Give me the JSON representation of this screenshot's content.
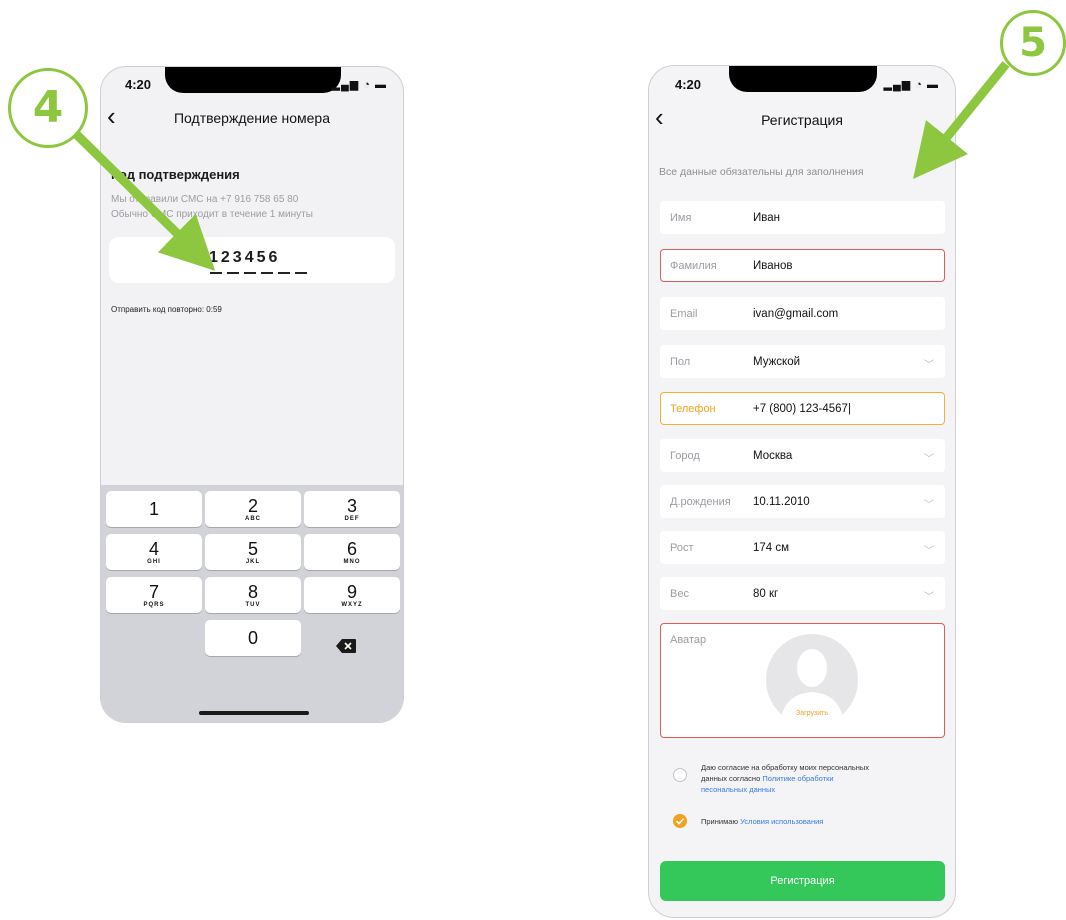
{
  "phone1": {
    "status_time": "4:20",
    "status_icons": "▂▄▆ ◔ ▬",
    "title": "Подтверждение номера",
    "code_heading": "Код подтверждения",
    "sms_line1": "Мы отправили СМС на +7 916 758 65 80",
    "sms_line2": "Обычно СМС приходит в течение 1 минуты",
    "code_value": "123456",
    "resend": "Отправить код повторно: 0:59",
    "keys": [
      {
        "num": "1",
        "letters": ""
      },
      {
        "num": "2",
        "letters": "ABC"
      },
      {
        "num": "3",
        "letters": "DEF"
      },
      {
        "num": "4",
        "letters": "GHI"
      },
      {
        "num": "5",
        "letters": "JKL"
      },
      {
        "num": "6",
        "letters": "MNO"
      },
      {
        "num": "7",
        "letters": "PQRS"
      },
      {
        "num": "8",
        "letters": "TUV"
      },
      {
        "num": "9",
        "letters": "WXYZ"
      },
      {
        "num": "0",
        "letters": ""
      }
    ]
  },
  "phone2": {
    "status_time": "4:20",
    "status_icons": "▂▄▆ ◔ ▬",
    "title": "Регистрация",
    "note": "Все данные обязательны для заполнения",
    "fields": [
      {
        "label": "Имя",
        "value": "Иван",
        "state": "normal",
        "dropdown": false
      },
      {
        "label": "Фамилия",
        "value": "Иванов",
        "state": "error",
        "dropdown": false
      },
      {
        "label": "Email",
        "value": "ivan@gmail.com",
        "state": "normal",
        "dropdown": false
      },
      {
        "label": "Пол",
        "value": "Мужской",
        "state": "normal",
        "dropdown": true
      },
      {
        "label": "Телефон",
        "value": "+7 (800) 123-4567|",
        "state": "focus",
        "dropdown": false
      },
      {
        "label": "Город",
        "value": "Москва",
        "state": "normal",
        "dropdown": true
      },
      {
        "label": "Д.рождения",
        "value": "10.11.2010",
        "state": "normal",
        "dropdown": true
      },
      {
        "label": "Рост",
        "value": "174 см",
        "state": "normal",
        "dropdown": true
      },
      {
        "label": "Вес",
        "value": "80 кг",
        "state": "normal",
        "dropdown": true
      }
    ],
    "avatar_label": "Аватар",
    "upload_label": "Загрузить",
    "consent_prefix_line1": "Даю согласие на обработку моих персональных",
    "consent_prefix_line2": "данных согласно ",
    "consent_link_line2": "Политике обработки",
    "consent_link_line3": "песональных данных",
    "consent_checked": false,
    "terms_prefix": "Принимаю ",
    "terms_link": "Условия использования",
    "terms_checked": true,
    "register_button": "Регистрация"
  },
  "badges": {
    "step4": "4",
    "step5": "5"
  },
  "colors": {
    "accent_green": "#8dc63f",
    "button_green": "#34c759",
    "error": "#e35a5a",
    "focus": "#f2b135",
    "link": "#3a7be0"
  }
}
